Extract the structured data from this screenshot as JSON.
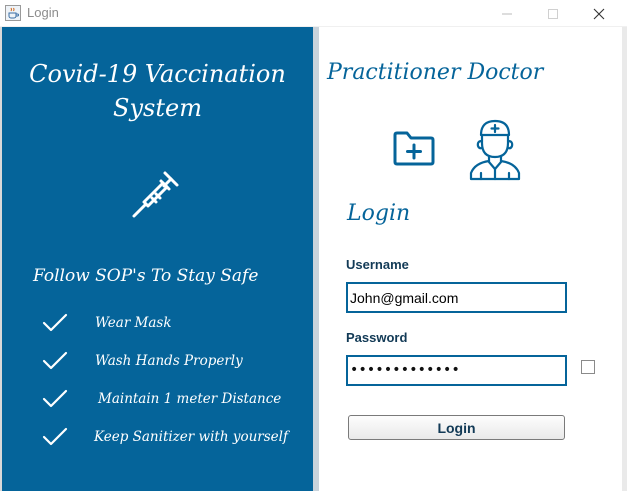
{
  "window": {
    "title": "Login",
    "icon": "java-cup-icon",
    "controls": [
      "minimize-icon",
      "maximize-icon",
      "close-icon"
    ]
  },
  "left_panel": {
    "title_line1": "Covid-19 Vaccination",
    "title_line2": "System",
    "icon": "syringe-icon",
    "sop_heading": "Follow SOP's To Stay Safe",
    "sop_items": [
      {
        "label": "Wear Mask",
        "icon": "check-icon"
      },
      {
        "label": "Wash Hands Properly",
        "icon": "check-icon"
      },
      {
        "label": "Maintain 1 meter Distance",
        "icon": "check-icon"
      },
      {
        "label": "Keep Sanitizer with yourself",
        "icon": "check-icon"
      }
    ]
  },
  "right_panel": {
    "role_title": "Practitioner Doctor",
    "icons": [
      "medical-folder-icon",
      "doctor-icon"
    ],
    "login_heading": "Login",
    "username_label": "Username",
    "username_value": "John@gmail.com",
    "password_label": "Password",
    "password_masked": "•••••••••••••",
    "login_button": "Login"
  },
  "colors": {
    "brand_blue": "#05649a",
    "panel_divider": "#c9d3db",
    "label_text": "#123a56",
    "white": "#ffffff"
  }
}
